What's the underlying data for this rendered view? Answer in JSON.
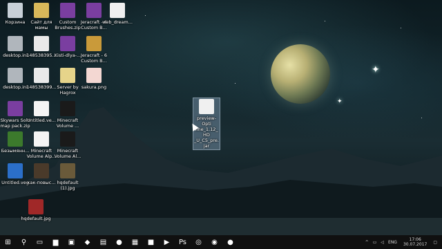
{
  "desktop": {
    "icons": [
      {
        "label": "Корзина",
        "icon": "recycle-bin-icon",
        "color": "#c7d0d8"
      },
      {
        "label": "Сайт для мамы",
        "icon": "folder-icon",
        "color": "#d8b85a"
      },
      {
        "label": "Custom Brushes.zip",
        "icon": "winrar-archive-icon",
        "color": "#7a3ea0"
      },
      {
        "label": "Jeracraft - 6 Custom B...",
        "icon": "winrar-archive-icon",
        "color": "#7a3ea0"
      },
      {
        "label": "web_dream...",
        "icon": "image-file-icon",
        "color": "#f0f0f0"
      },
      {
        "label": "desktop.ini",
        "icon": "settings-file-icon",
        "color": "#b0b6bc"
      },
      {
        "label": "148538395...",
        "icon": "image-file-icon",
        "color": "#e9e9e9"
      },
      {
        "label": "Kisti-dlya-...",
        "icon": "winrar-archive-icon",
        "color": "#7a3ea0"
      },
      {
        "label": "Jeracraft - 6 Custom B...",
        "icon": "folder-icon",
        "color": "#c99a3a"
      },
      {
        "label": "desktop.ini",
        "icon": "settings-file-icon",
        "color": "#b0b6bc"
      },
      {
        "label": "148538399...",
        "icon": "image-file-icon",
        "color": "#e9e9e9"
      },
      {
        "label": "Server by Hagrox",
        "icon": "folder-icon",
        "color": "#e6d48a"
      },
      {
        "label": "sakura.png",
        "icon": "image-file-icon",
        "color": "#f3d7d2"
      },
      {
        "label": "Skywars Solo map pack.zip",
        "icon": "winrar-archive-icon",
        "color": "#7a3ea0"
      },
      {
        "label": "Untitled.ve...",
        "icon": "document-icon",
        "color": "#f4f4f4"
      },
      {
        "label": "Minecraft Volume ...",
        "icon": "image-file-icon",
        "color": "#1a1a1a"
      },
      {
        "label": "Безымянн...",
        "icon": "image-file-icon",
        "color": "#3c7a2c"
      },
      {
        "label": "Minecraft Volume Alp...",
        "icon": "document-icon",
        "color": "#f4f4f4"
      },
      {
        "label": "Minecraft Volume Al...",
        "icon": "image-file-icon",
        "color": "#1a1a1a"
      },
      {
        "label": "Untitled.veg",
        "icon": "vegas-project-icon",
        "color": "#2b6fc9"
      },
      {
        "label": "как-повыс...",
        "icon": "image-file-icon",
        "color": "#4a3a2a"
      },
      {
        "label": "hqdefault (1).jpg",
        "icon": "image-file-icon",
        "color": "#6a5a3a"
      },
      {
        "label": "hqdefault.jpg",
        "icon": "image-file-icon",
        "color": "#a02828"
      },
      {
        "label": "preview-Opti fine_1.12_HD _U_C5_pre.jar",
        "icon": "java-jar-icon",
        "color": "#f0f0f0"
      }
    ]
  },
  "taskbar": {
    "buttons": [
      {
        "name": "start-button",
        "glyph": "⊞"
      },
      {
        "name": "search-button",
        "glyph": "⚲"
      },
      {
        "name": "task-view-button",
        "glyph": "▭"
      },
      {
        "name": "file-explorer-button",
        "glyph": "▆"
      },
      {
        "name": "photos-button",
        "glyph": "▣"
      },
      {
        "name": "sketch-app-button",
        "glyph": "◆"
      },
      {
        "name": "store-button",
        "glyph": "▤"
      },
      {
        "name": "opera-button",
        "glyph": "●"
      },
      {
        "name": "calculator-button",
        "glyph": "▦"
      },
      {
        "name": "minecraft-button",
        "glyph": "■"
      },
      {
        "name": "vegas-button",
        "glyph": "▶"
      },
      {
        "name": "photoshop-button",
        "glyph": "Ps"
      },
      {
        "name": "steam-button",
        "glyph": "◎"
      },
      {
        "name": "app-circle-button",
        "glyph": "◉"
      },
      {
        "name": "opera-gx-button",
        "glyph": "●"
      }
    ],
    "tray": {
      "chevron": "^",
      "language": "ENG",
      "time": "17:06",
      "date": "30.07.2017"
    }
  }
}
